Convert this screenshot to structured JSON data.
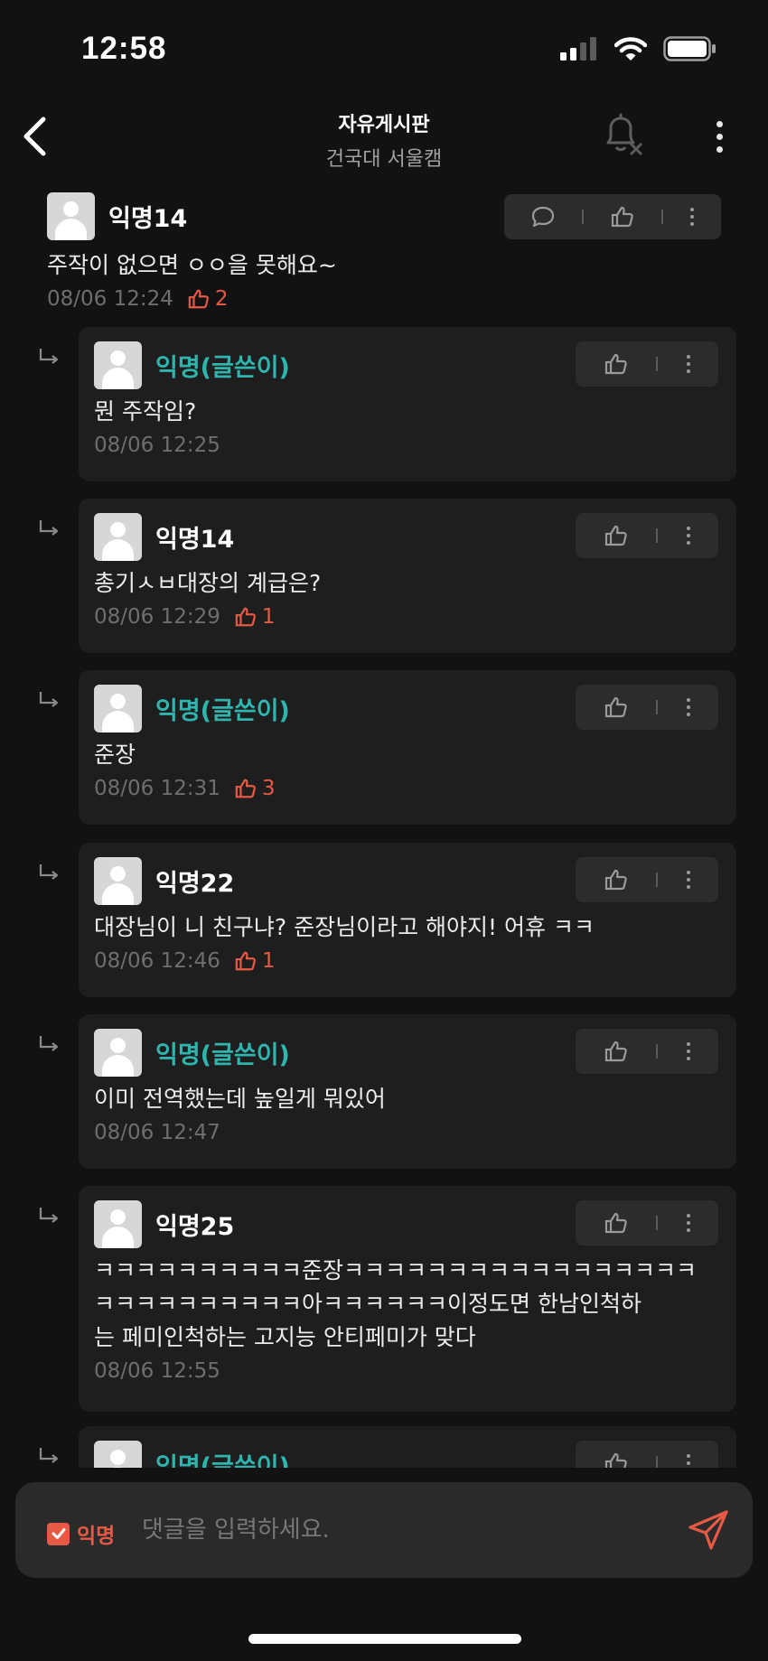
{
  "status_bar": {
    "time": "12:58"
  },
  "header": {
    "title": "자유게시판",
    "subtitle": "건국대 서울캠"
  },
  "top_comment": {
    "author": "익명14",
    "text": "주작이 없으면 ㅇㅇ을 못해요~",
    "time": "08/06 12:24",
    "likes": "2"
  },
  "replies": [
    {
      "author": "익명(글쓴이)",
      "is_op": true,
      "lines": [
        "뭔 주작임?"
      ],
      "time": "08/06 12:25",
      "likes": ""
    },
    {
      "author": "익명14",
      "is_op": false,
      "lines": [
        "총기ㅅㅂ대장의 계급은?"
      ],
      "time": "08/06 12:29",
      "likes": "1"
    },
    {
      "author": "익명(글쓴이)",
      "is_op": true,
      "lines": [
        "준장"
      ],
      "time": "08/06 12:31",
      "likes": "3"
    },
    {
      "author": "익명22",
      "is_op": false,
      "lines": [
        "대장님이 니 친구냐? 준장님이라고 해야지! 어휴 ㅋㅋ"
      ],
      "time": "08/06 12:46",
      "likes": "1"
    },
    {
      "author": "익명(글쓴이)",
      "is_op": true,
      "lines": [
        "이미 전역했는데 높일게 뭐있어"
      ],
      "time": "08/06 12:47",
      "likes": ""
    },
    {
      "author": "익명25",
      "is_op": false,
      "lines": [
        "ㅋㅋㅋㅋㅋㅋㅋㅋㅋㅋ준장ㅋㅋㅋㅋㅋㅋㅋㅋㅋㅋㅋㅋㅋㅋㅋㅋㅋ",
        "ㅋㅋㅋㅋㅋㅋㅋㅋㅋㅋ아ㅋㅋㅋㅋㅋㅋ이정도면 한남인척하",
        "는 페미인척하는 고지능 안티페미가 맞다"
      ],
      "time": "08/06 12:55",
      "likes": ""
    },
    {
      "author": "익명(글쓴이)",
      "is_op": true,
      "lines": [],
      "time": "",
      "likes": ""
    }
  ],
  "input_bar": {
    "anon_label": "익명",
    "anon_checked": true,
    "placeholder": "댓글을 입력하세요."
  },
  "icons": {
    "back": "chevron-left-icon",
    "notify": "bell-off-icon",
    "more": "more-vertical-icon",
    "reply": "speech-bubble-icon",
    "like": "thumbs-up-icon",
    "reply_arrow": "reply-arrow-icon",
    "send": "paper-plane-icon",
    "check": "check-icon"
  },
  "colors": {
    "background": "#121212",
    "card": "#1e1e1e",
    "pill": "#2c2c2c",
    "op_name": "#2fb4ae",
    "accent": "#e65a45",
    "muted": "#6e6e6e"
  }
}
